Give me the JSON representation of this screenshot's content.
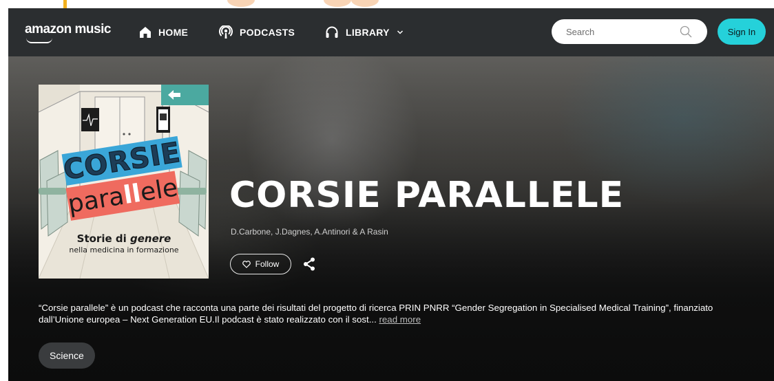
{
  "header": {
    "logo": "amazon music",
    "nav": {
      "home": "HOME",
      "podcasts": "PODCASTS",
      "library": "LIBRARY"
    },
    "search_placeholder": "Search",
    "sign_in": "Sign In"
  },
  "podcast": {
    "title": "CORSIE PARALLELE",
    "authors": "D.Carbone, J.Dagnes, A.Antinori & A Rasin",
    "follow_label": "Follow",
    "description": "“Corsie parallele” è un podcast che racconta una parte dei risultati del progetto di ricerca PRIN PNRR “Gender Segregation in Specialised Medical Training”, finanziato dall’Unione europea – Next Generation EU.Il podcast è stato realizzato con il sost...",
    "read_more": "read more",
    "genre": "Science"
  },
  "cover": {
    "line1": "CORSIE",
    "line2_a": "para",
    "line2_b": "ll",
    "line2_c": "ele",
    "subtitle_a": "Storie di ",
    "subtitle_b": "genere",
    "subtitle_c": "nella medicina in formazione"
  },
  "colors": {
    "accent": "#25d1da",
    "header_bg": "#2b2e30",
    "cover_blue": "#3aa6d8",
    "cover_red": "#ef6b5f"
  },
  "icons": {
    "home": "home-icon",
    "podcasts": "podcast-icon",
    "library": "headphones-icon",
    "search": "search-icon",
    "follow": "heart-icon",
    "share": "share-icon"
  }
}
